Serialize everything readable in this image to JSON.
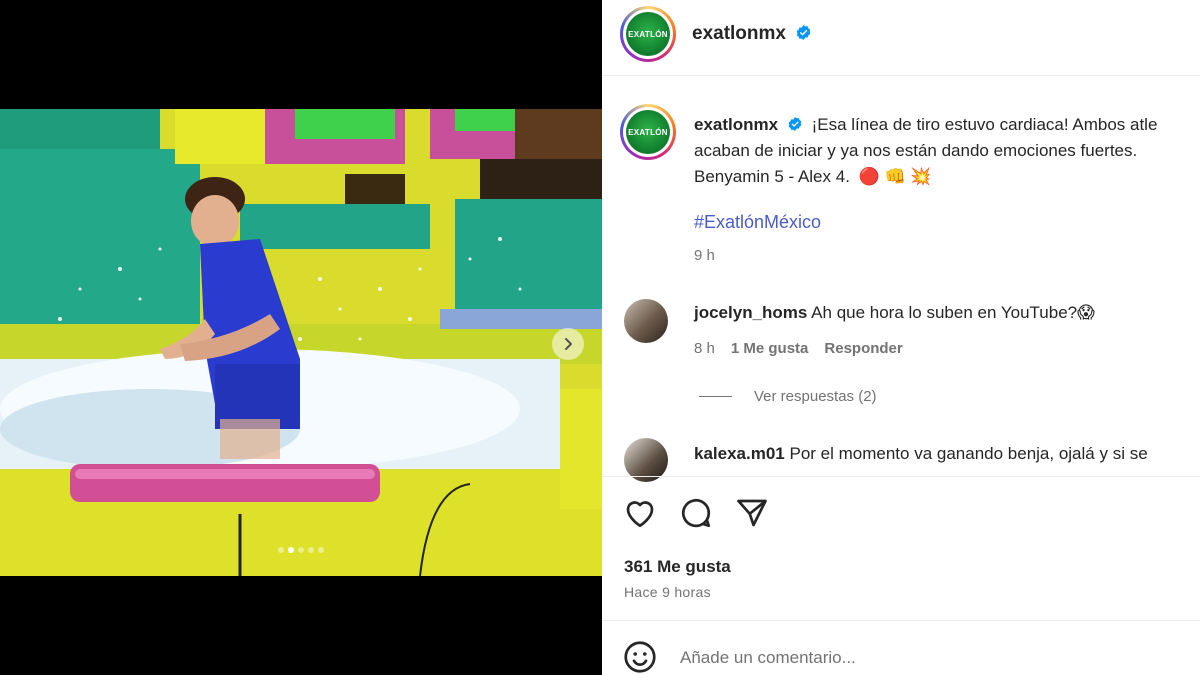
{
  "post": {
    "author": "exatlonmx",
    "avatar_text": "EXATLÓN",
    "caption": {
      "username": "exatlonmx",
      "line1": "¡Esa línea de tiro estuvo cardiaca! Ambos atle",
      "line2": "acaban de iniciar y ya nos están dando emociones fuertes.",
      "line3": "Benyamin 5 - Alex 4.",
      "emojis": "🔴 👊 💥",
      "hashtag": "#ExatlónMéxico",
      "time": "9 h"
    },
    "carousel": {
      "slide_count": 5,
      "active_index": 1
    },
    "comments": [
      {
        "username": "jocelyn_homs",
        "text": "Ah que hora lo suben en YouTube?😱",
        "time": "8 h",
        "likes": "1 Me gusta",
        "reply": "Responder",
        "view_replies": "Ver respuestas (2)"
      },
      {
        "username": "kalexa.m01",
        "text": "Por el momento va ganando benja, ojalá y si se"
      }
    ],
    "likes_label": "361 Me gusta",
    "posted_ago": "Hace 9 horas",
    "comment_placeholder": "Añade un comentario..."
  },
  "icons": {
    "verified": "verified-badge-icon",
    "like": "heart-icon",
    "comment": "comment-bubble-icon",
    "share": "paper-plane-icon",
    "emoji": "smiley-icon",
    "next": "chevron-right-icon"
  },
  "colors": {
    "verified": "#0095f6",
    "hashtag": "#4a5cc9",
    "brand_green": "#1a9a3a"
  }
}
